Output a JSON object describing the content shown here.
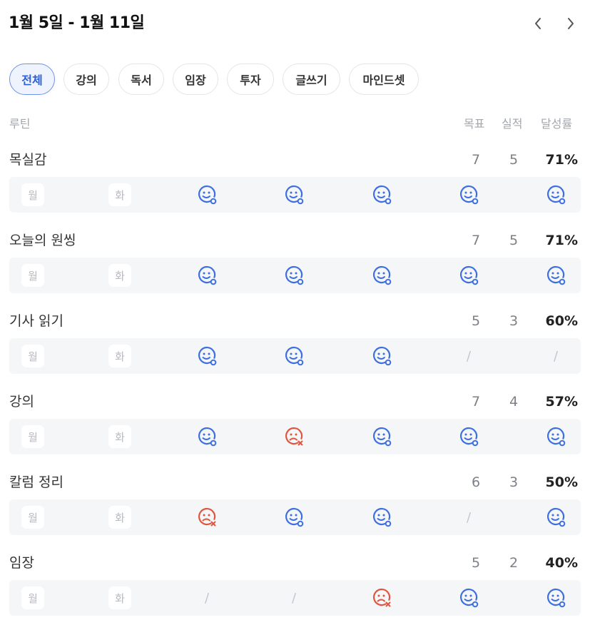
{
  "header": {
    "title": "1월 5일 - 1월 11일"
  },
  "tabs": [
    {
      "label": "전체",
      "active": true
    },
    {
      "label": "강의",
      "active": false
    },
    {
      "label": "독서",
      "active": false
    },
    {
      "label": "임장",
      "active": false
    },
    {
      "label": "투자",
      "active": false
    },
    {
      "label": "글쓰기",
      "active": false
    },
    {
      "label": "마인드셋",
      "active": false
    }
  ],
  "columns": {
    "routine": "루틴",
    "goal": "목표",
    "done": "실적",
    "rate": "달성률"
  },
  "day_labels": [
    "월",
    "화"
  ],
  "colors": {
    "success": "#3d6fe0",
    "fail": "#e0553f",
    "accent": "#2f5fd0"
  },
  "routines": [
    {
      "name": "목실감",
      "goal": "7",
      "done": "5",
      "rate": "71%",
      "days": [
        "label",
        "label",
        "success",
        "success",
        "success",
        "success",
        "success"
      ]
    },
    {
      "name": "오늘의 원씽",
      "goal": "7",
      "done": "5",
      "rate": "71%",
      "days": [
        "label",
        "label",
        "success",
        "success",
        "success",
        "success",
        "success"
      ]
    },
    {
      "name": "기사 읽기",
      "goal": "5",
      "done": "3",
      "rate": "60%",
      "days": [
        "label",
        "label",
        "success",
        "success",
        "success",
        "none",
        "none"
      ]
    },
    {
      "name": "강의",
      "goal": "7",
      "done": "4",
      "rate": "57%",
      "days": [
        "label",
        "label",
        "success",
        "fail",
        "success",
        "success",
        "success"
      ]
    },
    {
      "name": "칼럼 정리",
      "goal": "6",
      "done": "3",
      "rate": "50%",
      "days": [
        "label",
        "label",
        "fail",
        "success",
        "success",
        "none",
        "success"
      ]
    },
    {
      "name": "임장",
      "goal": "5",
      "done": "2",
      "rate": "40%",
      "days": [
        "label",
        "label",
        "none",
        "none",
        "fail",
        "success",
        "success"
      ]
    }
  ]
}
